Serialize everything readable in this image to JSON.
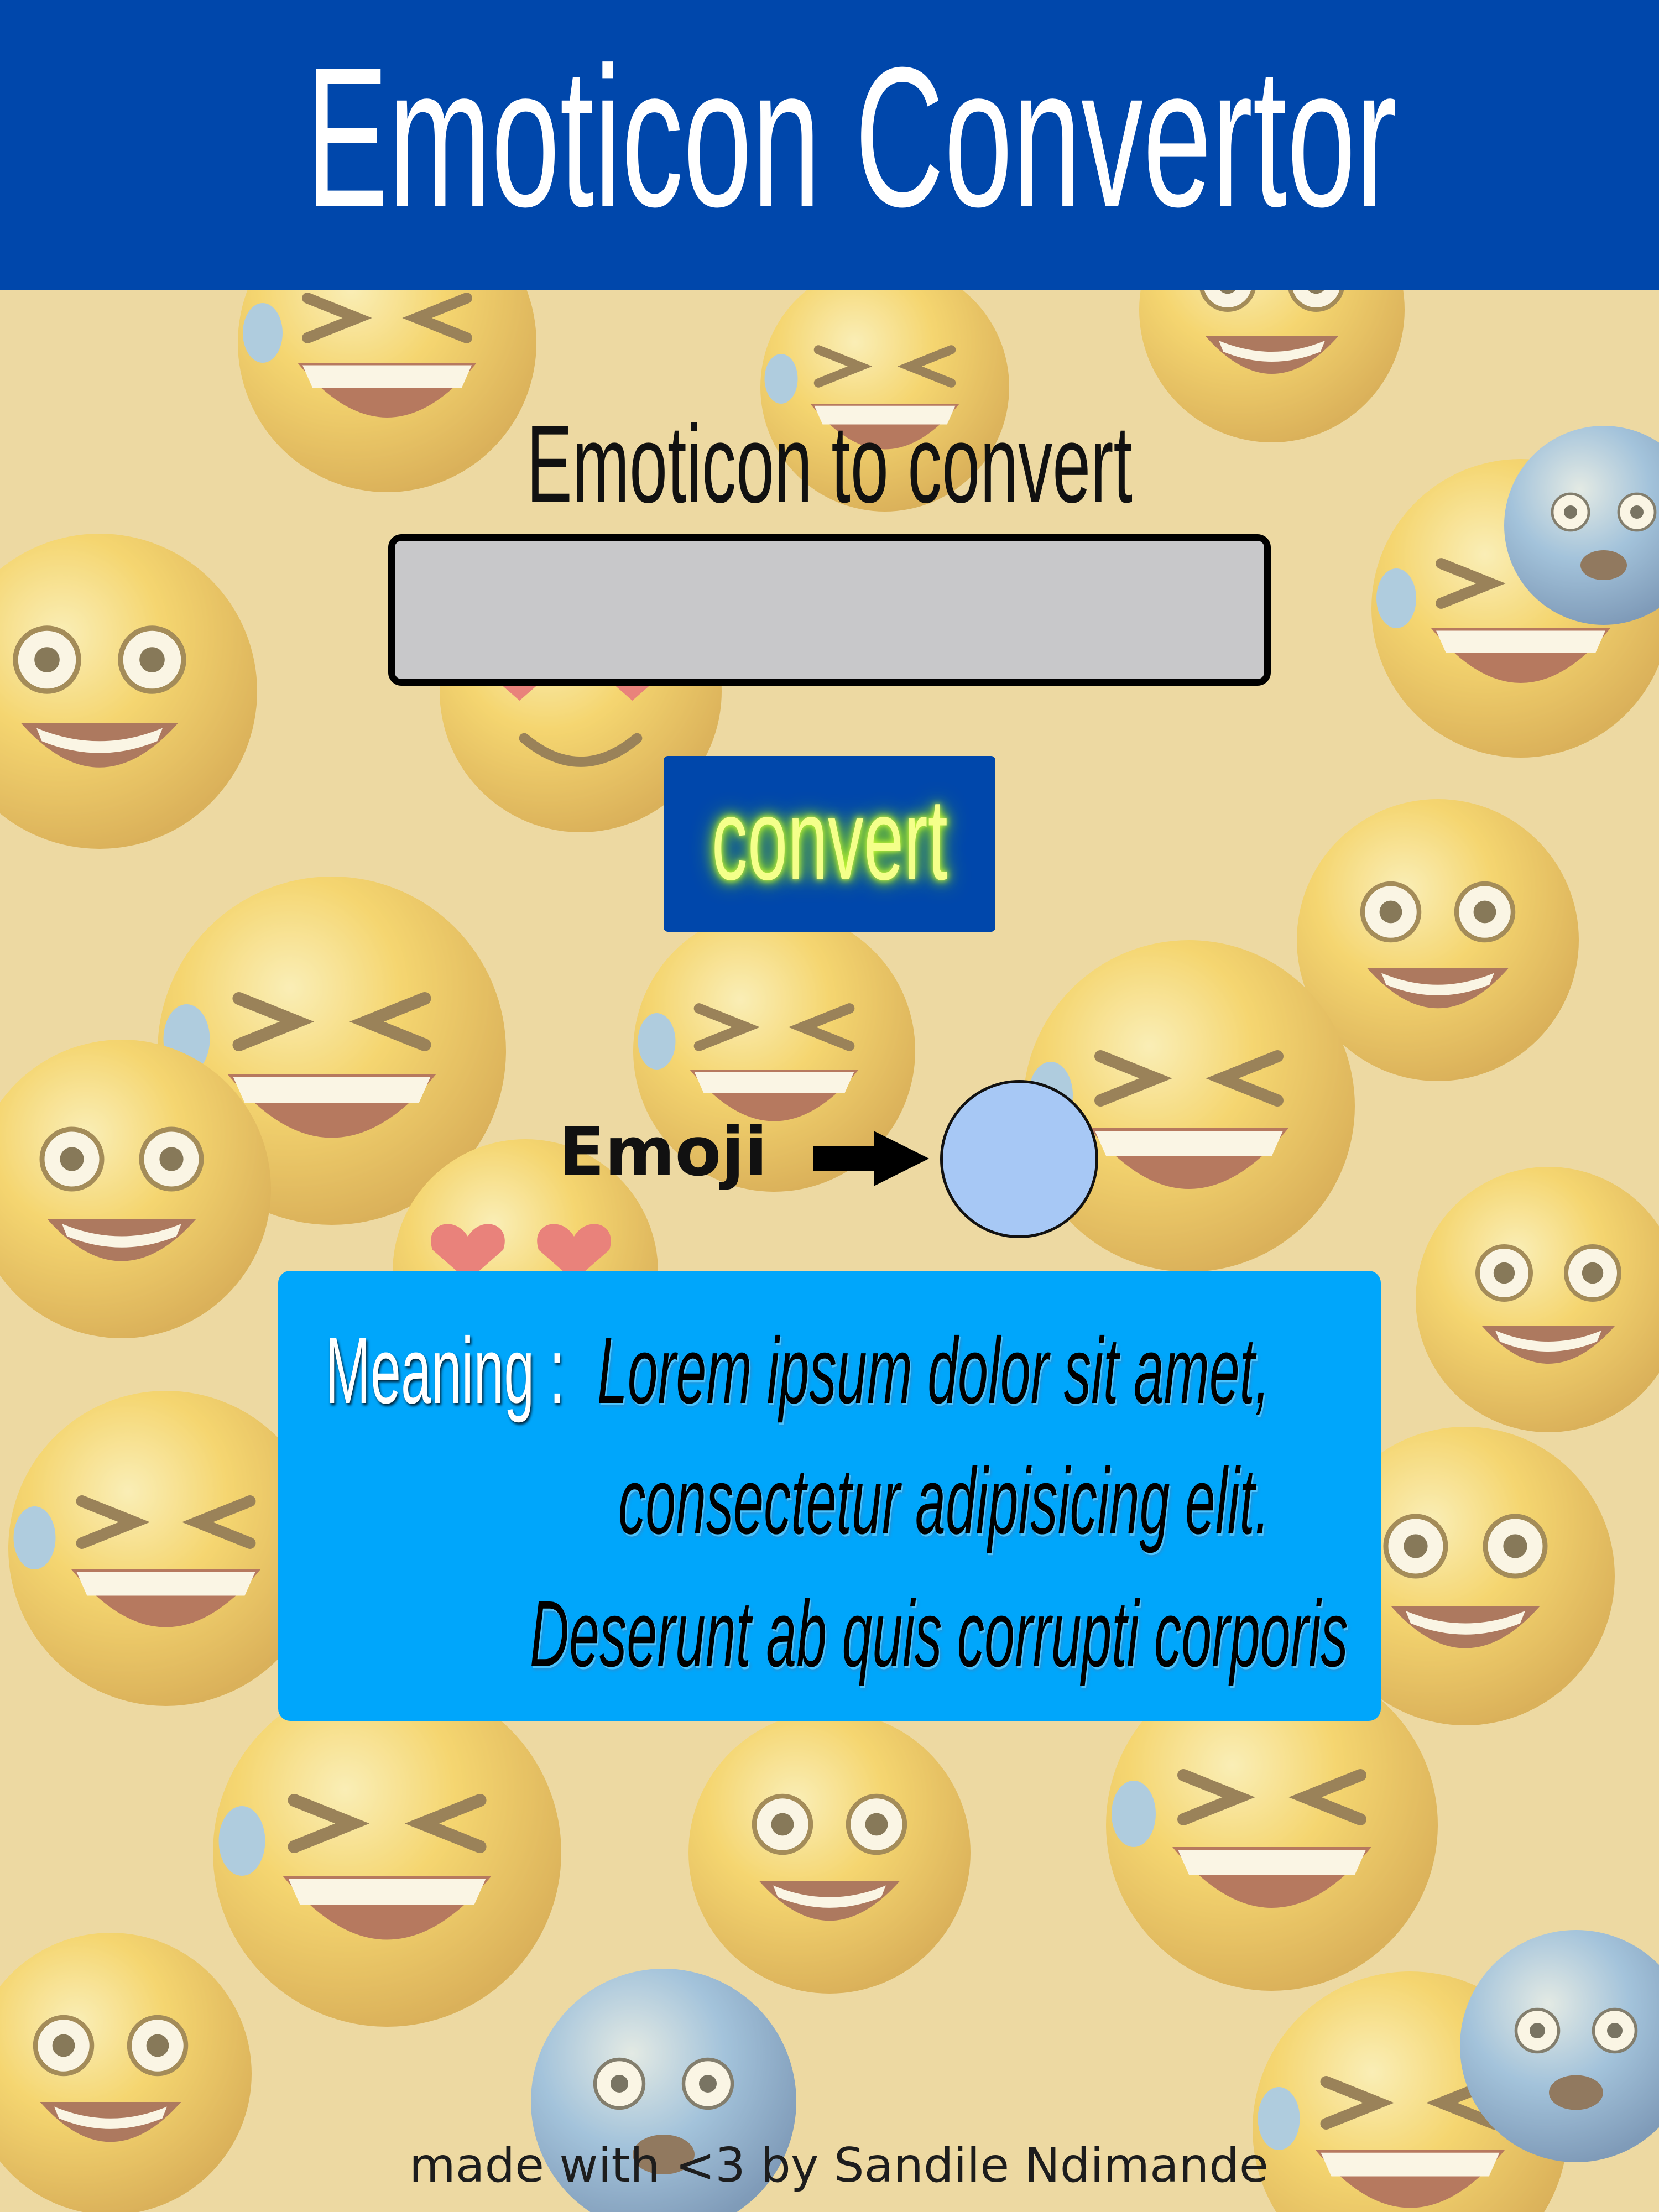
{
  "header": {
    "title": "Emoticon Convertor"
  },
  "converter": {
    "input_label": "Emoticon to convert",
    "input_value": "",
    "input_placeholder": "",
    "convert_button_label": "convert"
  },
  "result": {
    "emoji_label": "Emoji",
    "arrow_icon": "right-arrow-icon",
    "emoji_value": ""
  },
  "meaning": {
    "label": "Meaning :",
    "lines": [
      "Lorem ipsum dolor sit amet,",
      "consectetur adipisicing elit.",
      "Deserunt ab quis corrupti corporis"
    ]
  },
  "footer": {
    "credit": "made with <3 by Sandile Ndimande"
  },
  "colors": {
    "header_bg": "#0047ab",
    "button_bg": "#0047ab",
    "button_glow_text": "#f4ff8a",
    "meaning_bg": "#00a6fb",
    "emoji_circle": "#a7c8f5",
    "input_bg": "#c8c8ca"
  }
}
